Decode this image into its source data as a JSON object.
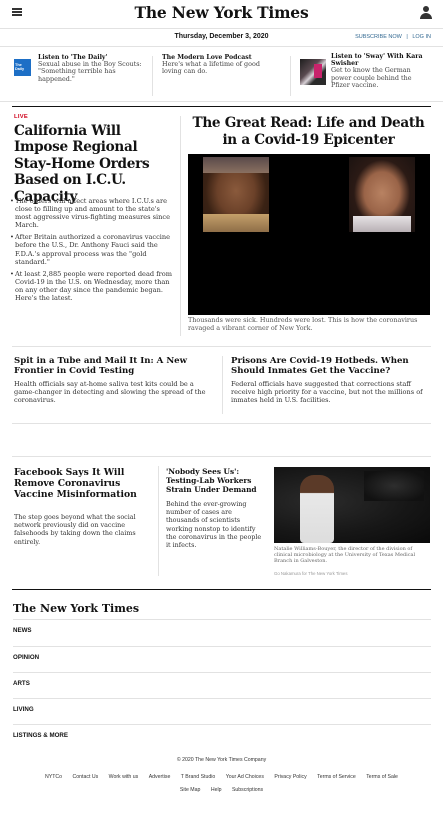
{
  "header": {
    "masthead": "The New York Times",
    "date": "Thursday, December 3, 2020",
    "subscribe": "SUBSCRIBE NOW",
    "login": "LOG IN",
    "menu_icon": "hamburger-menu-icon",
    "account_icon": "user-icon"
  },
  "promos": [
    {
      "thumb": "The Daily",
      "title": "Listen to 'The Daily'",
      "summary": "Sexual abuse in the Boy Scouts: \"Something terrible has happened.\""
    },
    {
      "title": "The Modern Love Podcast",
      "summary": "Here's what a lifetime of good loving can do."
    },
    {
      "title": "Listen to 'Sway' With Kara Swisher",
      "summary": "Get to know the German power couple behind the Pfizer vaccine."
    }
  ],
  "lead": {
    "kicker": "LIVE",
    "headline": "California Will Impose Regional Stay-Home Orders Based on I.C.U. Capacity",
    "bullets": [
      "The orders will affect areas where I.C.U.s are close to filling up and amount to the state's most aggressive virus-fighting measures since March.",
      "After Britain authorized a coronavirus vaccine before the U.S., Dr. Anthony Fauci said the F.D.A.'s approval process was the \"gold standard.\"",
      "At least 2,885 people were reported dead from Covid-19 in the U.S. on Wednesday, more than on any other day since the pandemic began. Here's the latest."
    ]
  },
  "great_read": {
    "headline": "The Great Read: Life and Death in a Covid-19 Epicenter",
    "caption": "Thousands were sick. Hundreds were lost. This is how the coronavirus ravaged a vibrant corner of New York."
  },
  "row2": [
    {
      "headline": "Spit in a Tube and Mail It In: A New Frontier in Covid Testing",
      "summary": "Health officials say at-home saliva test kits could be a game-changer in detecting and slowing the spread of the coronavirus."
    },
    {
      "headline": "Prisons Are Covid-19 Hotbeds. When Should Inmates Get the Vaccine?",
      "summary": "Federal officials have suggested that corrections staff receive high priority for a vaccine, but not the millions of inmates held in U.S. facilities."
    }
  ],
  "facebook": {
    "headline": "Facebook Says It Will Remove Coronavirus Vaccine Misinformation",
    "summary": "The step goes beyond what the social network previously did on vaccine falsehoods by taking down the claims entirely."
  },
  "nobody_sees": {
    "headline": "'Nobody Sees Us': Testing-Lab Workers Strain Under Demand",
    "summary": "Behind the ever-growing number of cases are thousands of scientists working nonstop to identify the coronavirus in the people it infects.",
    "photo_caption": "Natalie Williams-Bouyer, the director of the division of clinical microbiology at the University of Texas Medical Branch in Galveston.",
    "photo_credit": "Go Nakamura for The New York Times"
  },
  "footer": {
    "logo": "The New York Times",
    "sections": [
      "NEWS",
      "OPINION",
      "ARTS",
      "LIVING",
      "LISTINGS & MORE"
    ],
    "copyright": "© 2020 The New York Times Company",
    "links_row1": [
      "NYTCo",
      "Contact Us",
      "Work with us",
      "Advertise",
      "T Brand Studio",
      "Your Ad Choices",
      "Privacy Policy",
      "Terms of Service",
      "Terms of Sale"
    ],
    "links_row2": [
      "Site Map",
      "Help",
      "Subscriptions"
    ]
  }
}
